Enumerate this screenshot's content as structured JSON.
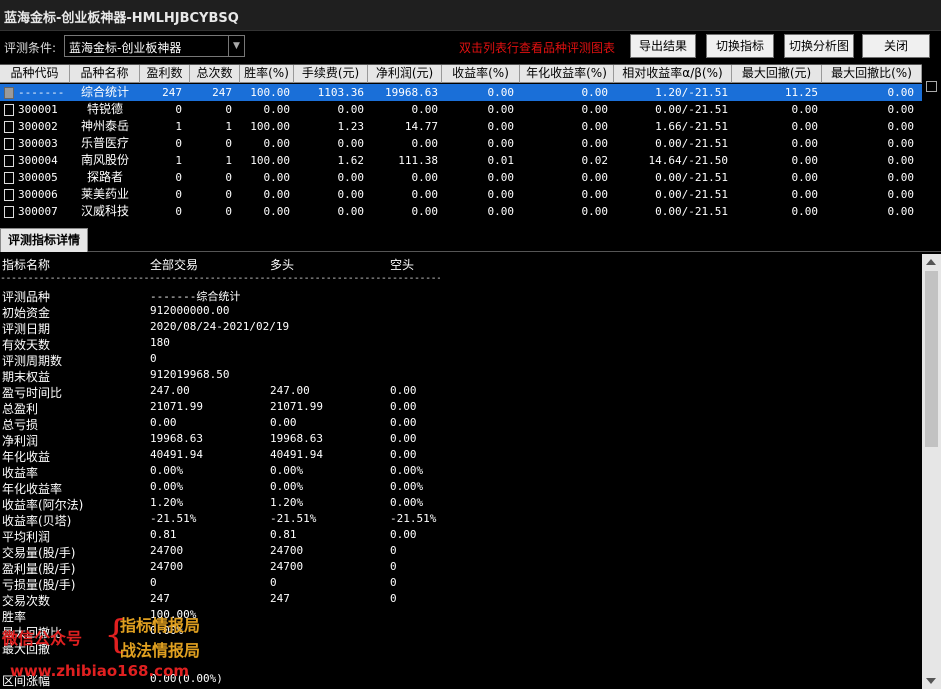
{
  "window": {
    "title": "蓝海金标-创业板神器-HMLHJBCYBSQ"
  },
  "toolbar": {
    "criteria_label": "评测条件:",
    "criteria_value": "蓝海金标-创业板神器",
    "hint": "双击列表行查看品种评测图表",
    "buttons": [
      "导出结果",
      "切换指标",
      "切换分析图",
      "关闭"
    ]
  },
  "grid": {
    "columns": [
      "品种代码",
      "品种名称",
      "盈利数",
      "总次数",
      "胜率(%)",
      "手续费(元)",
      "净利润(元)",
      "收益率(%)",
      "年化收益率(%)",
      "相对收益率α/β(%)",
      "最大回撤(元)",
      "最大回撤比(%)"
    ],
    "rows": [
      [
        "-------",
        "综合统计",
        "247",
        "247",
        "100.00",
        "1103.36",
        "19968.63",
        "0.00",
        "0.00",
        "1.20/-21.51",
        "11.25",
        "0.00"
      ],
      [
        "300001",
        "特锐德",
        "0",
        "0",
        "0.00",
        "0.00",
        "0.00",
        "0.00",
        "0.00",
        "0.00/-21.51",
        "0.00",
        "0.00"
      ],
      [
        "300002",
        "神州泰岳",
        "1",
        "1",
        "100.00",
        "1.23",
        "14.77",
        "0.00",
        "0.00",
        "1.66/-21.51",
        "0.00",
        "0.00"
      ],
      [
        "300003",
        "乐普医疗",
        "0",
        "0",
        "0.00",
        "0.00",
        "0.00",
        "0.00",
        "0.00",
        "0.00/-21.51",
        "0.00",
        "0.00"
      ],
      [
        "300004",
        "南风股份",
        "1",
        "1",
        "100.00",
        "1.62",
        "111.38",
        "0.01",
        "0.02",
        "14.64/-21.50",
        "0.00",
        "0.00"
      ],
      [
        "300005",
        "探路者",
        "0",
        "0",
        "0.00",
        "0.00",
        "0.00",
        "0.00",
        "0.00",
        "0.00/-21.51",
        "0.00",
        "0.00"
      ],
      [
        "300006",
        "莱美药业",
        "0",
        "0",
        "0.00",
        "0.00",
        "0.00",
        "0.00",
        "0.00",
        "0.00/-21.51",
        "0.00",
        "0.00"
      ],
      [
        "300007",
        "汉威科技",
        "0",
        "0",
        "0.00",
        "0.00",
        "0.00",
        "0.00",
        "0.00",
        "0.00/-21.51",
        "0.00",
        "0.00"
      ]
    ]
  },
  "tab": {
    "label": "评测指标详情"
  },
  "detail": {
    "headers": [
      "指标名称",
      "全部交易",
      "多头",
      "空头"
    ],
    "separator": "---------------------------------------------------------------------------------------------",
    "rows": [
      [
        "评测品种",
        "-------综合统计",
        "",
        ""
      ],
      [
        "初始资金",
        "912000000.00",
        "",
        ""
      ],
      [
        "评测日期",
        "2020/08/24-2021/02/19",
        "",
        ""
      ],
      [
        "有效天数",
        "180",
        "",
        ""
      ],
      [
        "评测周期数",
        "0",
        "",
        ""
      ],
      [
        "期末权益",
        "912019968.50",
        "",
        ""
      ],
      [
        "盈亏时间比",
        "247.00",
        "247.00",
        "0.00"
      ],
      [
        "总盈利",
        "21071.99",
        "21071.99",
        "0.00"
      ],
      [
        "总亏损",
        "0.00",
        "0.00",
        "0.00"
      ],
      [
        "净利润",
        "19968.63",
        "19968.63",
        "0.00"
      ],
      [
        "年化收益",
        "40491.94",
        "40491.94",
        "0.00"
      ],
      [
        "收益率",
        "0.00%",
        "0.00%",
        "0.00%"
      ],
      [
        "年化收益率",
        "0.00%",
        "0.00%",
        "0.00%"
      ],
      [
        "收益率(阿尔法)",
        "1.20%",
        "1.20%",
        "0.00%"
      ],
      [
        "收益率(贝塔)",
        "-21.51%",
        "-21.51%",
        "-21.51%"
      ],
      [
        "平均利润",
        "0.81",
        "0.81",
        "0.00"
      ],
      [
        "交易量(股/手)",
        "24700",
        "24700",
        "0"
      ],
      [
        "盈利量(股/手)",
        "24700",
        "24700",
        "0"
      ],
      [
        "亏损量(股/手)",
        "0",
        "0",
        "0"
      ],
      [
        "交易次数",
        "247",
        "247",
        "0"
      ],
      [
        "胜率",
        "100.00%",
        "",
        ""
      ],
      [
        "最大回撤比",
        "0.00%",
        "",
        ""
      ],
      [
        "最大回撤",
        "",
        "",
        ""
      ],
      [
        "",
        "",
        "",
        ""
      ],
      [
        "区间涨幅",
        "0.00(0.00%)",
        "",
        ""
      ]
    ]
  },
  "watermark": {
    "left": "微信公众号",
    "brace": "{",
    "line1": "指标情报局",
    "line2": "战法情报局",
    "url": "www.zhibiao168.com"
  }
}
